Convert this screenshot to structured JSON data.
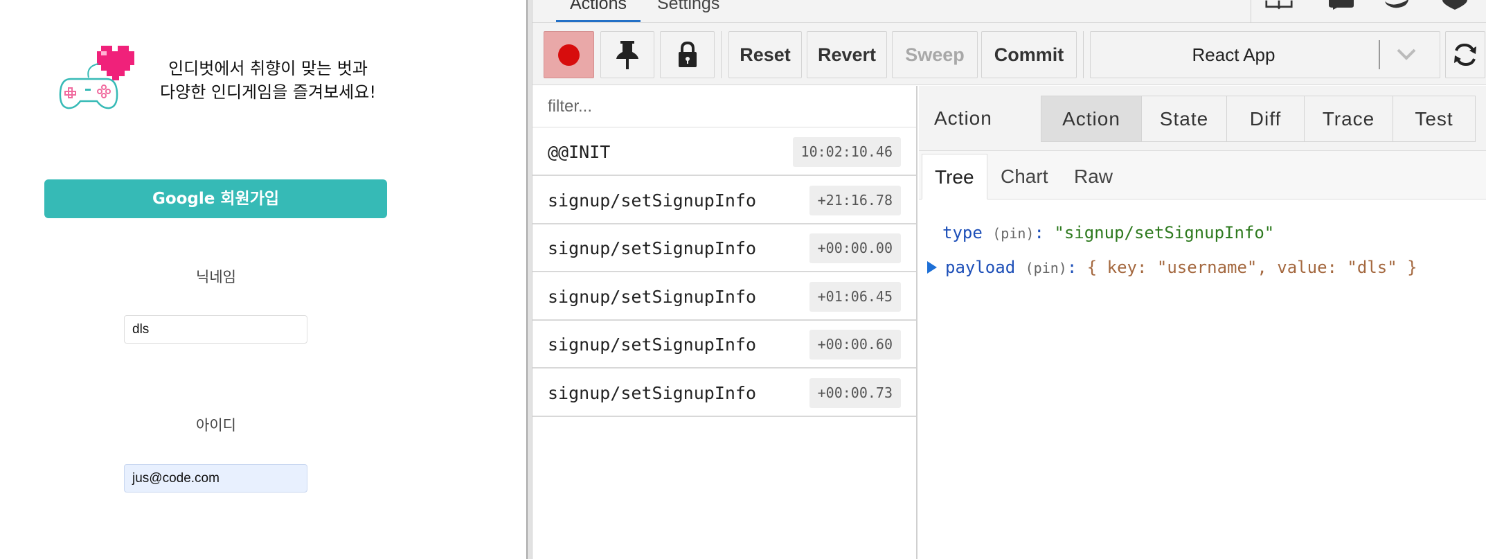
{
  "app": {
    "tagline_line1": "인디벗에서 취향이 맞는 벗과",
    "tagline_line2": "다양한 인디게임을 즐겨보세요!",
    "google_button": "Google 회원가입",
    "nickname_label": "닉네임",
    "nickname_value": "dls",
    "id_label": "아이디",
    "id_value": "jus@code.com"
  },
  "devtools": {
    "tabs": {
      "actions": "Actions",
      "settings": "Settings"
    },
    "top_icons": [
      "book-icon",
      "chat-icon",
      "twitter-icon",
      "heart-icon"
    ],
    "toolbar": {
      "reset": "Reset",
      "revert": "Revert",
      "sweep": "Sweep",
      "commit": "Commit",
      "instance": "React App",
      "record_color": "#d70d0d"
    },
    "filter_placeholder": "filter...",
    "actions": [
      {
        "name": "@@INIT",
        "time": "10:02:10.46"
      },
      {
        "name": "signup/setSignupInfo",
        "time": "+21:16.78"
      },
      {
        "name": "signup/setSignupInfo",
        "time": "+00:00.00"
      },
      {
        "name": "signup/setSignupInfo",
        "time": "+01:06.45"
      },
      {
        "name": "signup/setSignupInfo",
        "time": "+00:00.60"
      },
      {
        "name": "signup/setSignupInfo",
        "time": "+00:00.73"
      }
    ],
    "detail": {
      "title": "Action",
      "segments": [
        "Action",
        "State",
        "Diff",
        "Trace",
        "Test"
      ],
      "active_segment": "Action",
      "view_tabs": [
        "Tree",
        "Chart",
        "Raw"
      ],
      "active_view": "Tree",
      "tree": {
        "type_key": "type",
        "type_tag": "(pin)",
        "type_value": "\"signup/setSignupInfo\"",
        "payload_key": "payload",
        "payload_tag": "(pin)",
        "payload_value": "{ key: \"username\", value: \"dls\" }"
      }
    }
  }
}
